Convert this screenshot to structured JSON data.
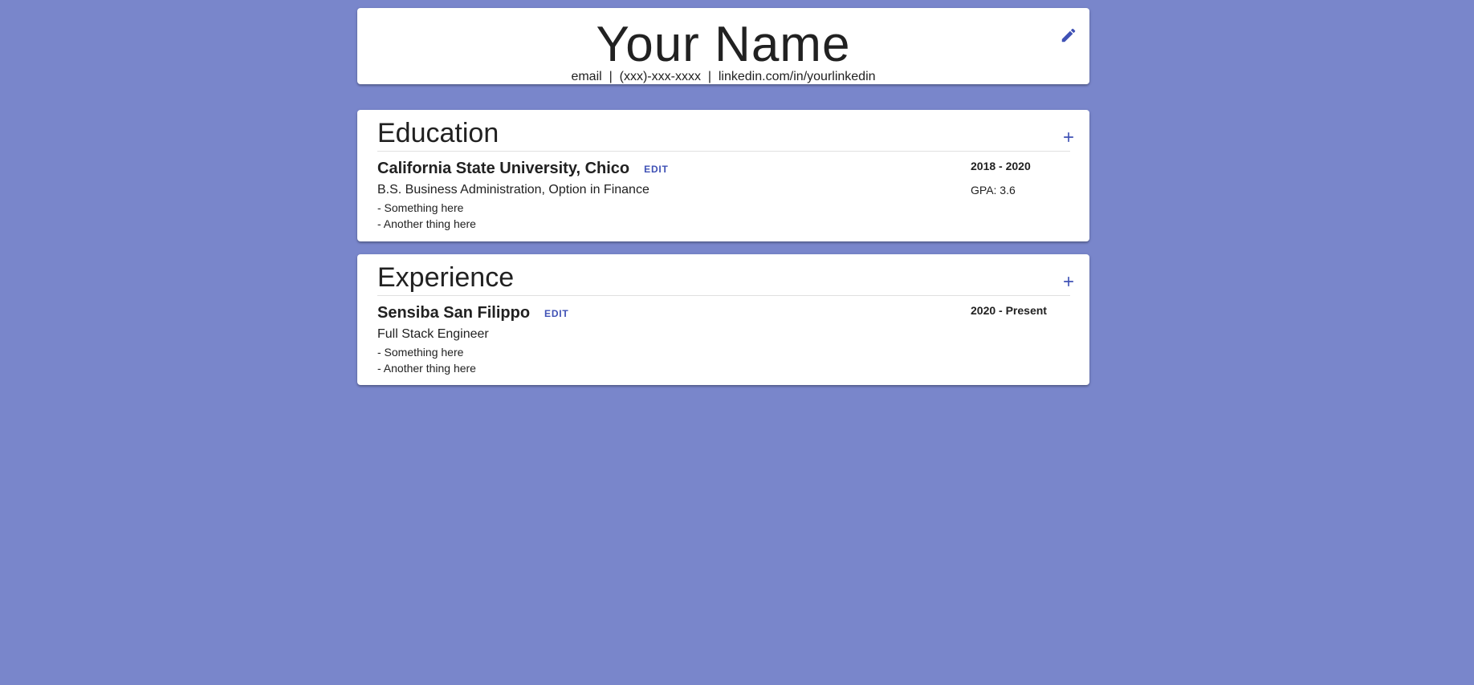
{
  "header": {
    "name": "Your Name",
    "contact": "email  |  (xxx)-xxx-xxxx  |  linkedin.com/in/yourlinkedin",
    "edit_icon": "pencil-icon"
  },
  "education": {
    "title": "Education",
    "add_icon": "plus-icon",
    "entry": {
      "institution": "California State University, Chico",
      "edit_label": "EDIT",
      "dates": "2018 - 2020",
      "degree": "B.S. Business Administration, Option in Finance",
      "gpa": "GPA: 3.6",
      "bullets": [
        "- Something here",
        "- Another thing here"
      ]
    }
  },
  "experience": {
    "title": "Experience",
    "add_icon": "plus-icon",
    "entry": {
      "company": "Sensiba San Filippo",
      "edit_label": "EDIT",
      "dates": "2020 - Present",
      "role": "Full Stack Engineer",
      "bullets": [
        "- Something here",
        "- Another thing here"
      ]
    }
  },
  "colors": {
    "background": "#7986cb",
    "accent": "#3f51b5",
    "card": "#ffffff"
  }
}
